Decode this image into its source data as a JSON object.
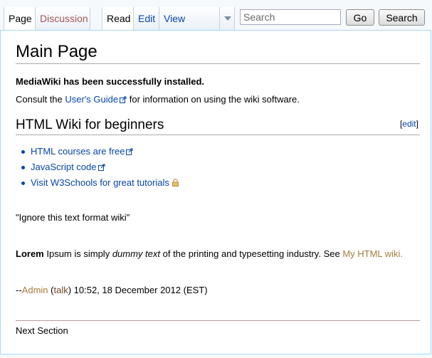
{
  "tabs": {
    "page": "Page",
    "discussion": "Discussion",
    "read": "Read",
    "edit": "Edit",
    "view_history": "View history"
  },
  "search": {
    "placeholder": "Search",
    "go_label": "Go",
    "search_label": "Search"
  },
  "page": {
    "title": "Main Page",
    "installed": "MediaWiki has been successfully installed.",
    "consult_pre": "Consult the ",
    "consult_link": "User's Guide",
    "consult_post": " for information on using the wiki software.",
    "section_title": "HTML Wiki for beginners",
    "section_edit": "edit",
    "links": [
      "HTML courses are free",
      "JavaScript code",
      "Visit W3Schools for great tutorials"
    ],
    "quote": "\"Ignore this text format wiki\"",
    "lorem_bold": "Lorem",
    "lorem_1": " Ipsum is simply ",
    "lorem_italic": "dummy text",
    "lorem_2": " of the printing and typesetting industry. See ",
    "lorem_link": "My HTML wiki.",
    "sig_dash": "--",
    "sig_user": "Admin",
    "sig_talk": "talk",
    "sig_time": " 10:52, 18 December 2012 (EST)",
    "next_section": "Next Section"
  },
  "colors": {
    "link": "#0645ad",
    "new_link": "#a55858",
    "visited_link": "#a67d3d"
  },
  "icons": {
    "external": "external-link-icon",
    "lock": "lock-icon",
    "more": "chevron-down-icon"
  }
}
